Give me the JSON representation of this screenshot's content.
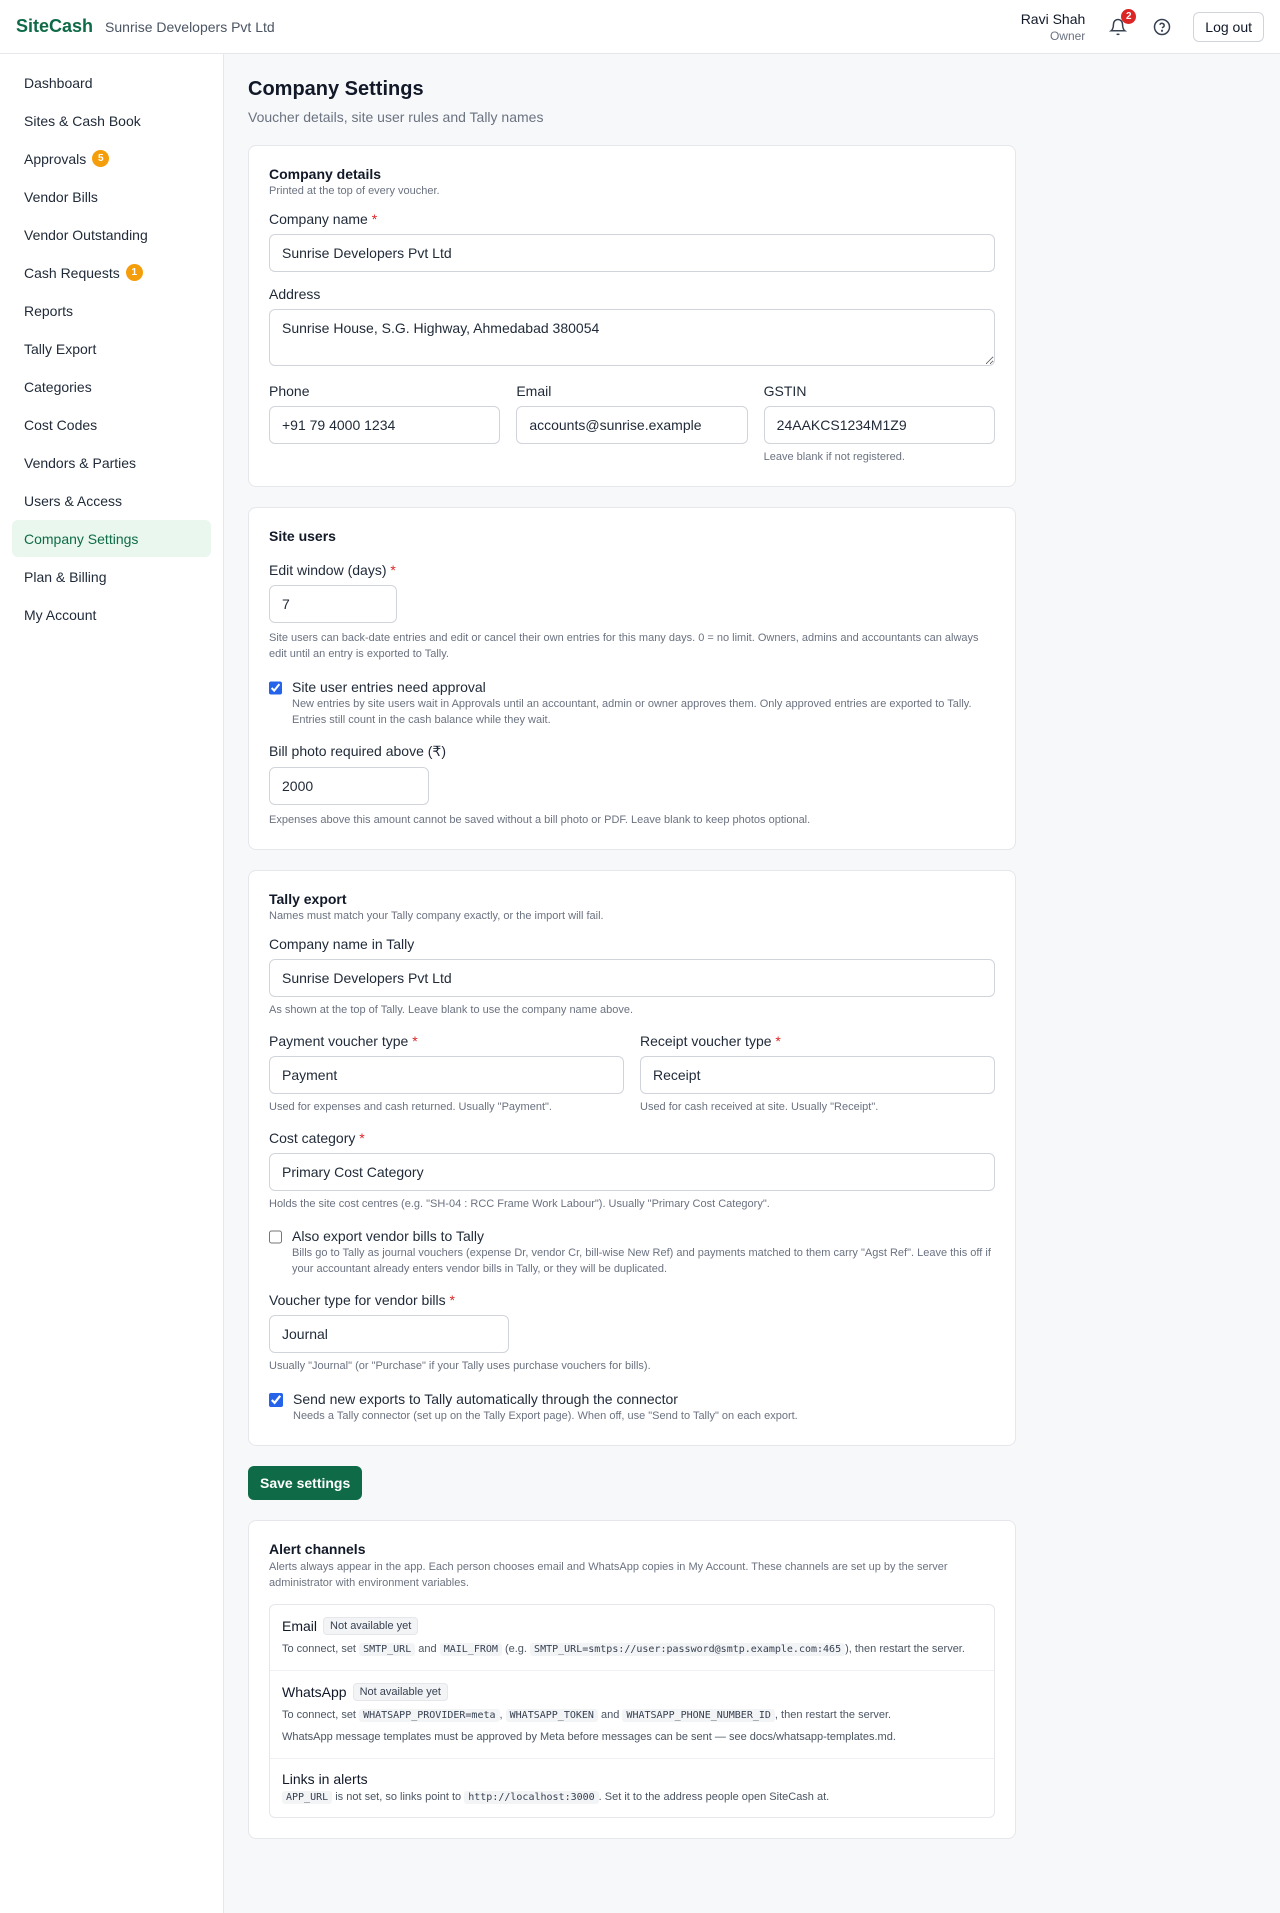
{
  "header": {
    "brand": "SiteCash",
    "company": "Sunrise Developers Pvt Ltd",
    "user_name": "Ravi Shah",
    "user_role": "Owner",
    "notifications": "2",
    "logout": "Log out"
  },
  "sidebar": {
    "items": [
      {
        "label": "Dashboard"
      },
      {
        "label": "Sites & Cash Book"
      },
      {
        "label": "Approvals",
        "count": "5"
      },
      {
        "label": "Vendor Bills"
      },
      {
        "label": "Vendor Outstanding"
      },
      {
        "label": "Cash Requests",
        "count": "1"
      },
      {
        "label": "Reports"
      },
      {
        "label": "Tally Export"
      },
      {
        "label": "Categories"
      },
      {
        "label": "Cost Codes"
      },
      {
        "label": "Vendors & Parties"
      },
      {
        "label": "Users & Access"
      },
      {
        "label": "Company Settings"
      },
      {
        "label": "Plan & Billing"
      },
      {
        "label": "My Account"
      }
    ]
  },
  "page": {
    "title": "Company Settings",
    "subtitle": "Voucher details, site user rules and Tally names"
  },
  "company_details": {
    "title": "Company details",
    "subtitle": "Printed at the top of every voucher.",
    "name_label": "Company name",
    "name_value": "Sunrise Developers Pvt Ltd",
    "address_label": "Address",
    "address_value": "Sunrise House, S.G. Highway, Ahmedabad 380054",
    "phone_label": "Phone",
    "phone_value": "+91 79 4000 1234",
    "email_label": "Email",
    "email_value": "accounts@sunrise.example",
    "gstin_label": "GSTIN",
    "gstin_value": "24AAKCS1234M1Z9",
    "gstin_help": "Leave blank if not registered."
  },
  "site_users": {
    "title": "Site users",
    "edit_label": "Edit window (days)",
    "edit_value": "7",
    "edit_help": "Site users can back-date entries and edit or cancel their own entries for this many days. 0 = no limit. Owners, admins and accountants can always edit until an entry is exported to Tally.",
    "approval_label": "Site user entries need approval",
    "approval_help": "New entries by site users wait in Approvals until an accountant, admin or owner approves them. Only approved entries are exported to Tally. Entries still count in the cash balance while they wait.",
    "approval_checked": true,
    "photo_label": "Bill photo required above (₹)",
    "photo_value": "2000",
    "photo_help": "Expenses above this amount cannot be saved without a bill photo or PDF. Leave blank to keep photos optional."
  },
  "tally": {
    "title": "Tally export",
    "subtitle": "Names must match your Tally company exactly, or the import will fail.",
    "company_label": "Company name in Tally",
    "company_value": "Sunrise Developers Pvt Ltd",
    "company_help": "As shown at the top of Tally. Leave blank to use the company name above.",
    "payment_label": "Payment voucher type",
    "payment_value": "Payment",
    "payment_help": "Used for expenses and cash returned. Usually \"Payment\".",
    "receipt_label": "Receipt voucher type",
    "receipt_value": "Receipt",
    "receipt_help": "Used for cash received at site. Usually \"Receipt\".",
    "cost_label": "Cost category",
    "cost_value": "Primary Cost Category",
    "cost_help": "Holds the site cost centres (e.g. \"SH-04 : RCC Frame Work Labour\"). Usually \"Primary Cost Category\".",
    "vendor_label": "Also export vendor bills to Tally",
    "vendor_help": "Bills go to Tally as journal vouchers (expense Dr, vendor Cr, bill-wise New Ref) and payments matched to them carry \"Agst Ref\". Leave this off if your accountant already enters vendor bills in Tally, or they will be duplicated.",
    "vendor_checked": false,
    "vtype_label": "Voucher type for vendor bills",
    "vtype_value": "Journal",
    "vtype_help": "Usually \"Journal\" (or \"Purchase\" if your Tally uses purchase vouchers for bills).",
    "auto_label": "Send new exports to Tally automatically through the connector",
    "auto_help": "Needs a Tally connector (set up on the Tally Export page). When off, use \"Send to Tally\" on each export.",
    "auto_checked": true
  },
  "save_label": "Save settings",
  "alerts": {
    "title": "Alert channels",
    "subtitle": "Alerts always appear in the app. Each person chooses email and WhatsApp copies in My Account. These channels are set up by the server administrator with environment variables.",
    "email_title": "Email",
    "email_status": "Not available yet",
    "email_t1": "To connect, set",
    "email_c1": "SMTP_URL",
    "email_t2": "and",
    "email_c2": "MAIL_FROM",
    "email_t3": "(e.g.",
    "email_c3": "SMTP_URL=smtps://user:password@smtp.example.com:465",
    "email_t4": "), then restart the server.",
    "wa_title": "WhatsApp",
    "wa_status": "Not available yet",
    "wa_t1": "To connect, set",
    "wa_c1": "WHATSAPP_PROVIDER=meta",
    "wa_t2": ",",
    "wa_c2": "WHATSAPP_TOKEN",
    "wa_t3": "and",
    "wa_c3": "WHATSAPP_PHONE_NUMBER_ID",
    "wa_t4": ", then restart the server.",
    "wa_note": "WhatsApp message templates must be approved by Meta before messages can be sent — see docs/whatsapp-templates.md.",
    "links_title": "Links in alerts",
    "links_c1": "APP_URL",
    "links_t1": "is not set, so links point to",
    "links_c2": "http://localhost:3000",
    "links_t2": ". Set it to the address people open SiteCash at."
  }
}
